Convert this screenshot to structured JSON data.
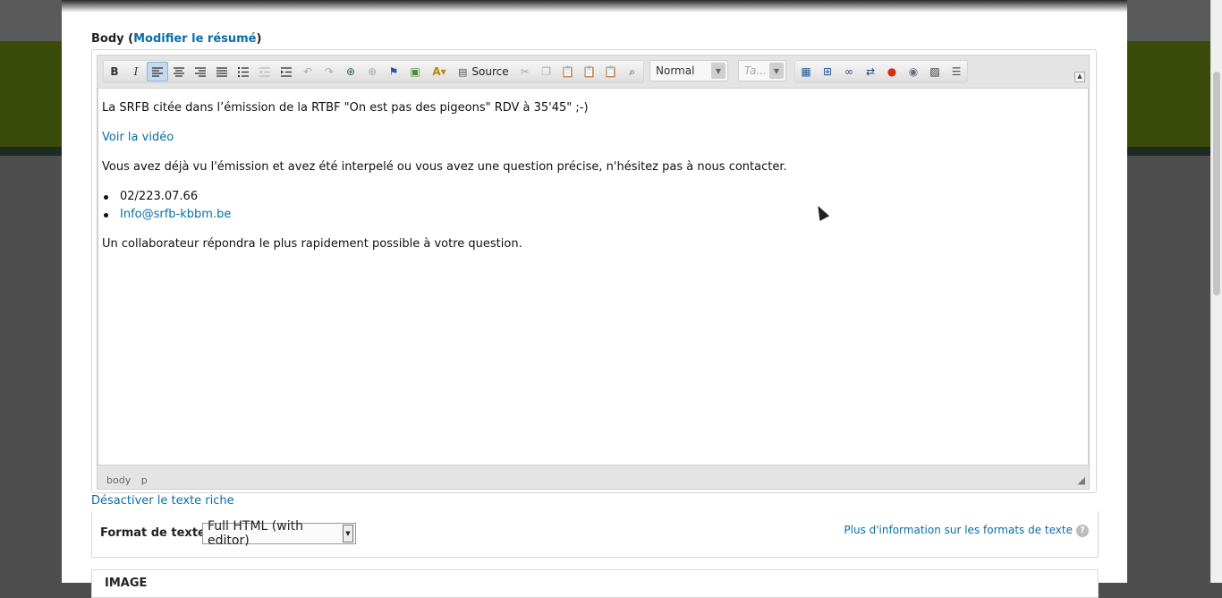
{
  "header": {
    "label": "Body",
    "edit_summary_link": "Modifier le résumé"
  },
  "toolbar": {
    "source_label": "Source",
    "format_combo": "Normal",
    "font_combo": "Ta..."
  },
  "content": {
    "p1": "La SRFB citée dans l’émission de la RTBF \"On est pas des pigeons\" RDV à 35'45\" ;-)",
    "video_link": "Voir la vidéo",
    "p2": "Vous avez déjà vu l'émission et avez été interpelé ou vous avez une question précise, n'hésitez pas à nous contacter.",
    "list": [
      "02/223.07.66",
      "Info@srfb-kbbm.be"
    ],
    "p3": "Un collaborateur répondra le plus rapidement possible à votre question."
  },
  "path_bar": [
    "body",
    "p"
  ],
  "disable_rich_text_link": "Désactiver le texte riche",
  "text_format": {
    "label": "Format de texte",
    "selected": "Full HTML (with editor)",
    "info_link": "Plus d'information sur les formats de texte"
  },
  "image_section": {
    "label": "IMAGE"
  },
  "colors": {
    "link": "#0a6ea8",
    "overlay": "#4e4e4e",
    "green_band": "#3a4a08"
  }
}
